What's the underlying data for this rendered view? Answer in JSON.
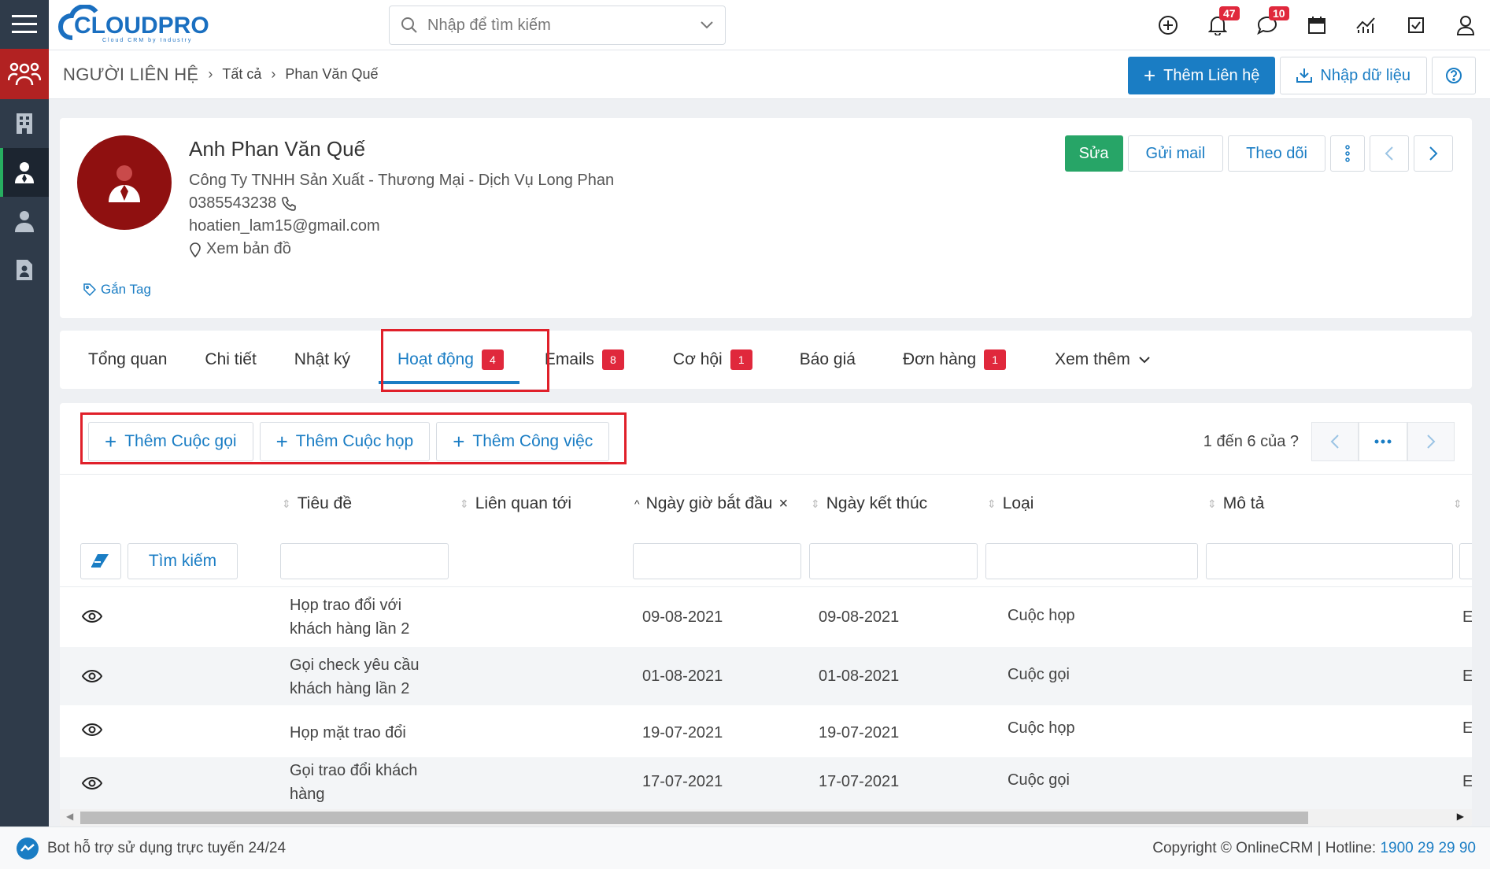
{
  "brand": {
    "logo_text": "CLOUDPRO",
    "logo_sub": "Cloud CRM by Industry"
  },
  "search": {
    "placeholder": "Nhập để tìm kiếm"
  },
  "topbar": {
    "bell_count": "47",
    "chat_count": "10"
  },
  "breadcrumb": {
    "module": "NGƯỜI LIÊN HỆ",
    "level1": "Tất cả",
    "level2": "Phan Văn Quế"
  },
  "header_actions": {
    "add_contact": "Thêm Liên hệ",
    "import": "Nhập dữ liệu"
  },
  "profile": {
    "name": "Anh Phan Văn Quế",
    "company": "Công Ty TNHH Sản Xuất - Thương Mại - Dịch Vụ Long Phan",
    "phone": "0385543238",
    "email": "hoatien_lam15@gmail.com",
    "map_link": "Xem bản đồ",
    "tag_link": "Gắn Tag",
    "actions": {
      "edit": "Sửa",
      "send_mail": "Gửi mail",
      "follow": "Theo dõi"
    }
  },
  "tabs": [
    {
      "label": "Tổng quan",
      "badge": ""
    },
    {
      "label": "Chi tiết",
      "badge": ""
    },
    {
      "label": "Nhật ký",
      "badge": ""
    },
    {
      "label": "Hoạt động",
      "badge": "4"
    },
    {
      "label": "Emails",
      "badge": "8"
    },
    {
      "label": "Cơ hội",
      "badge": "1"
    },
    {
      "label": "Báo giá",
      "badge": ""
    },
    {
      "label": "Đơn hàng",
      "badge": "1"
    },
    {
      "label": "Xem thêm",
      "badge": ""
    }
  ],
  "activity": {
    "add_call": "Thêm Cuộc gọi",
    "add_meeting": "Thêm Cuộc họp",
    "add_task": "Thêm Công việc",
    "pager_text": "1 đến 6 của",
    "pager_unknown": "?",
    "search_button": "Tìm kiếm",
    "columns": {
      "title": "Tiêu đề",
      "related": "Liên quan tới",
      "start": "Ngày giờ bắt đầu",
      "end": "Ngày kết thúc",
      "type": "Loại",
      "desc": "Mô tả"
    },
    "rows": [
      {
        "title1": "Họp trao đổi với",
        "title2": "khách hàng lần 2",
        "start": "09-08-2021",
        "end": "09-08-2021",
        "type": "Cuộc họp",
        "tail": "E"
      },
      {
        "title1": "Gọi check yêu cầu",
        "title2": "khách hàng lần 2",
        "start": "01-08-2021",
        "end": "01-08-2021",
        "type": "Cuộc gọi",
        "tail": "E"
      },
      {
        "title1": "Họp mặt trao đổi",
        "title2": "",
        "start": "19-07-2021",
        "end": "19-07-2021",
        "type": "Cuộc họp",
        "tail": "E"
      },
      {
        "title1": "Gọi trao đổi khách",
        "title2": "hàng",
        "start": "17-07-2021",
        "end": "17-07-2021",
        "type": "Cuộc gọi",
        "tail": "E"
      }
    ]
  },
  "footer": {
    "bot_text": "Bot hỗ trợ sử dụng trực tuyến 24/24",
    "copyright": "Copyright © OnlineCRM | Hotline: ",
    "hotline": "1900 29 29 90"
  },
  "colors": {
    "primary": "#1a7dc4",
    "danger": "#e0283c",
    "success": "#27a567",
    "sidebar": "#2f3b4a"
  }
}
